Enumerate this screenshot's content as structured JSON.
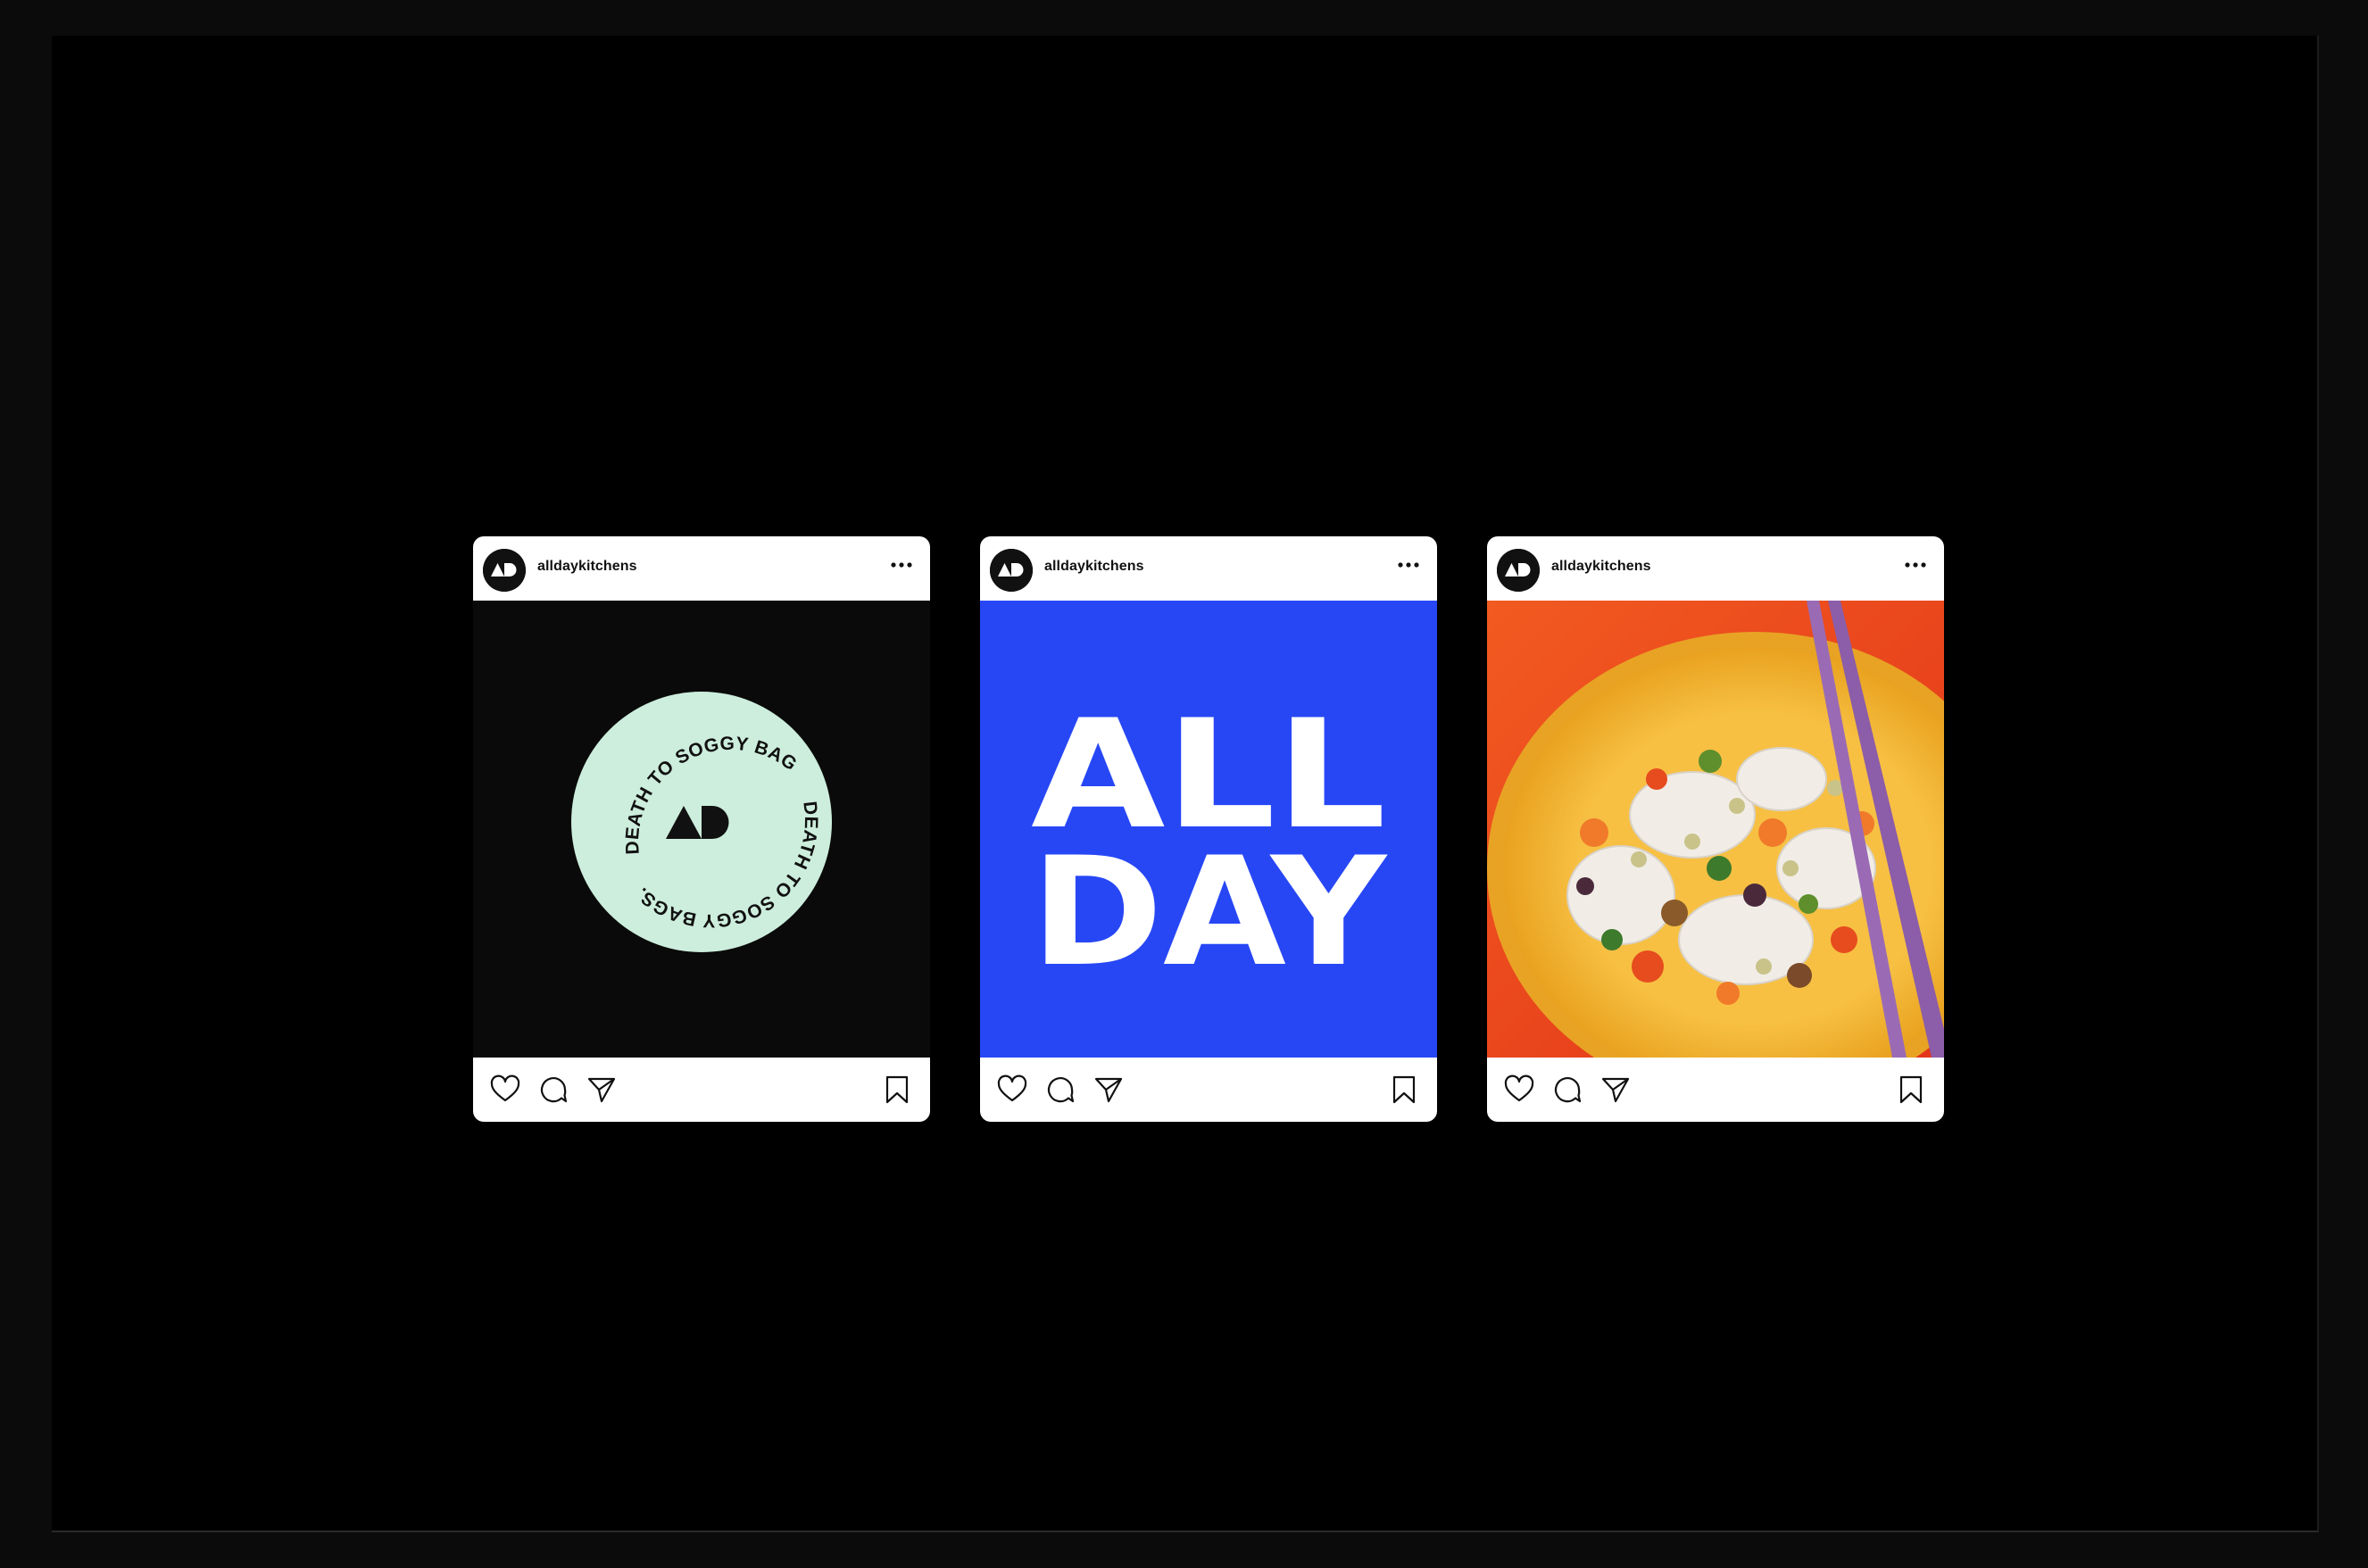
{
  "posts": [
    {
      "username": "alldaykitchens",
      "avatar_icon": "ad-logo-icon",
      "media": {
        "kind": "badge",
        "background": "#0a0a0a",
        "badge_color": "#cdeedd",
        "ring_text_top": "DEATH TO SOGGY BAGS.",
        "ring_text_bottom": "DEATH TO SOGGY BAGS.",
        "logo": "AD"
      }
    },
    {
      "username": "alldaykitchens",
      "avatar_icon": "ad-logo-icon",
      "media": {
        "kind": "wordmark",
        "background": "#2747f5",
        "line1": "ALL",
        "line2": "DAY"
      }
    },
    {
      "username": "alldaykitchens",
      "avatar_icon": "ad-logo-icon",
      "media": {
        "kind": "photo",
        "description_icon": "food-bowl-photo",
        "colors": {
          "background": "#ef4b1d",
          "bowl": "#f5b632",
          "chopsticks": "#9a6bb4"
        }
      }
    }
  ],
  "actions": {
    "icons": [
      "heart-icon",
      "comment-icon",
      "share-icon",
      "bookmark-icon"
    ]
  },
  "colors": {
    "page_bg": "#0b0b0b",
    "frame_bg": "#000000",
    "card_bg": "#ffffff",
    "text": "#111111"
  }
}
